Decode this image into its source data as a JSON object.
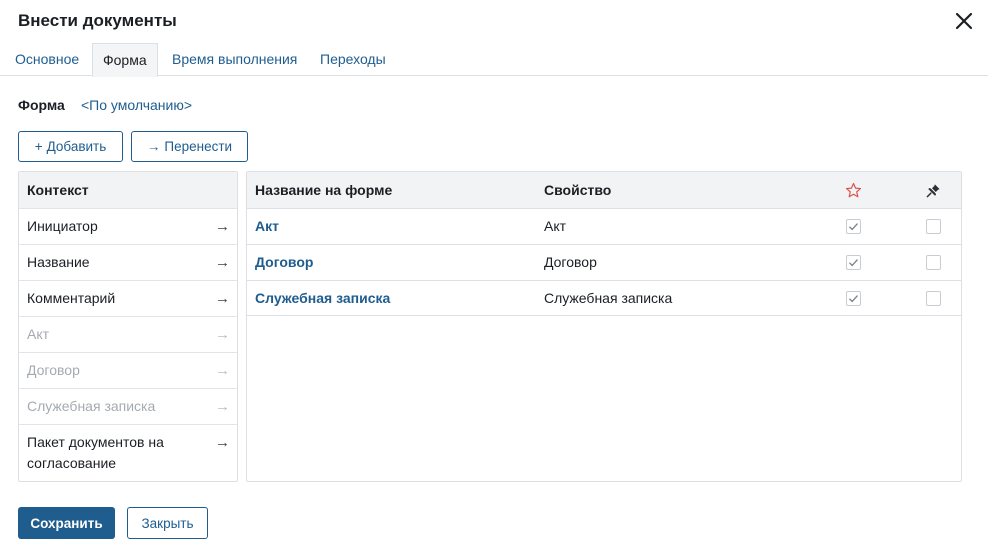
{
  "dialog": {
    "title": "Внести документы"
  },
  "tabs": [
    {
      "label": "Основное",
      "active": false
    },
    {
      "label": "Форма",
      "active": true
    },
    {
      "label": "Время выполнения",
      "active": false
    },
    {
      "label": "Переходы",
      "active": false
    }
  ],
  "form": {
    "label": "Форма",
    "value": "<По умолчанию>"
  },
  "toolbar": {
    "add_icon": "+",
    "add_label": "Добавить",
    "move_icon": "→",
    "move_label": "Перенести"
  },
  "context": {
    "header": "Контекст",
    "items": [
      {
        "label": "Инициатор",
        "disabled": false
      },
      {
        "label": "Название",
        "disabled": false
      },
      {
        "label": "Комментарий",
        "disabled": false
      },
      {
        "label": "Акт",
        "disabled": true
      },
      {
        "label": "Договор",
        "disabled": true
      },
      {
        "label": "Служебная записка",
        "disabled": true
      },
      {
        "label": "Пакет документов на согласование",
        "disabled": false
      }
    ],
    "arrow_glyph": "→"
  },
  "fields": {
    "headers": {
      "name": "Название на форме",
      "property": "Свойство",
      "required_icon": "star-icon",
      "readonly_icon": "pin-icon"
    },
    "rows": [
      {
        "name": "Акт",
        "property": "Акт",
        "required": true,
        "readonly": false
      },
      {
        "name": "Договор",
        "property": "Договор",
        "required": true,
        "readonly": false
      },
      {
        "name": "Служебная записка",
        "property": "Служебная записка",
        "required": true,
        "readonly": false
      }
    ]
  },
  "footer": {
    "save_label": "Сохранить",
    "close_label": "Закрыть"
  },
  "colors": {
    "accent": "#1f5d8f",
    "star": "#d9534f",
    "border": "#dcdfe3",
    "disabled_text": "#a5aab0"
  }
}
